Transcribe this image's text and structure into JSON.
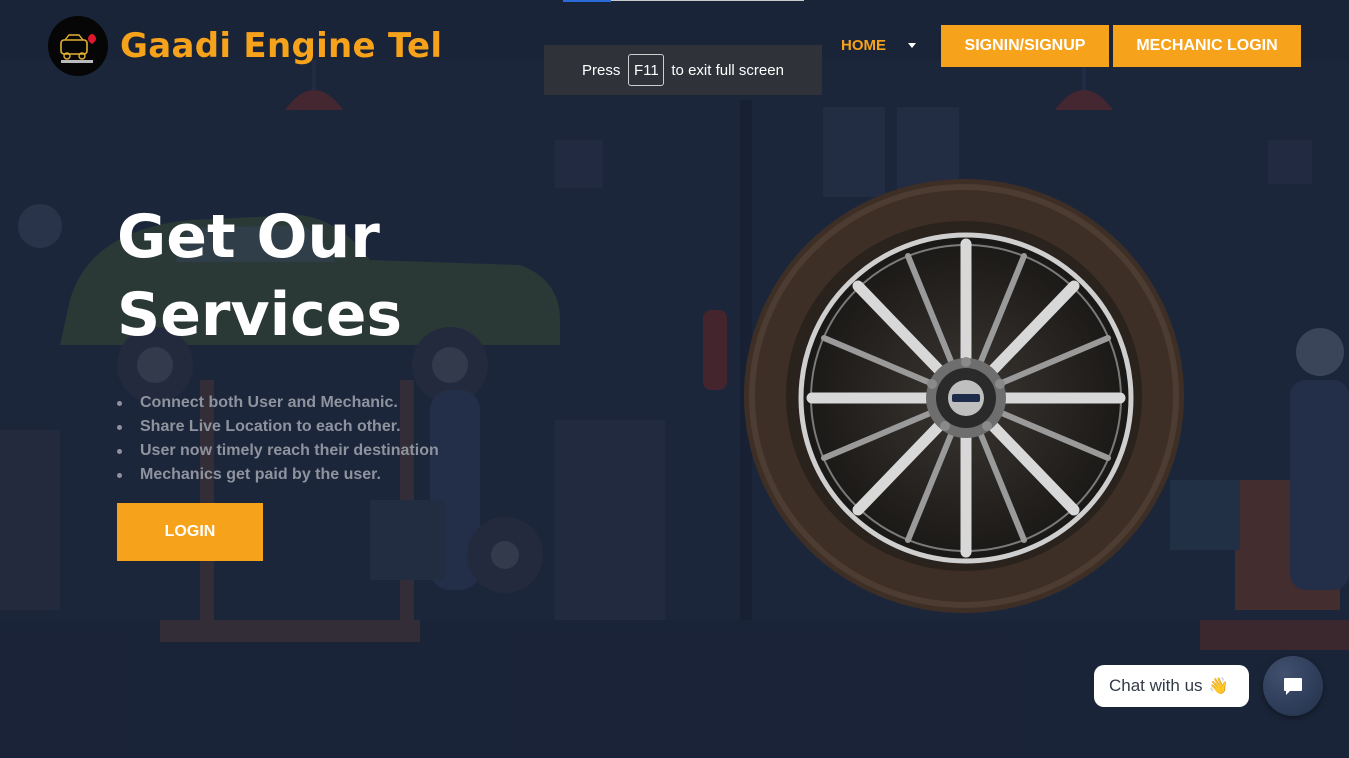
{
  "browser": {
    "fullscreen_hint": {
      "press": "Press",
      "key": "F11",
      "suffix": "to exit full screen"
    }
  },
  "header": {
    "brand": "Gaadi Engine Tel",
    "logo_icon": "car-engine-logo-icon",
    "nav": {
      "home": "HOME",
      "dropdown_icon": "caret-down-icon"
    },
    "signin_button": "SIGNIN/SIGNUP",
    "mechanic_login_button": "MECHANIC LOGIN"
  },
  "hero": {
    "title_line1": "Get Our",
    "title_line2": "Services",
    "features": [
      "Connect both User and Mechanic.",
      "Share Live Location to each other.",
      "User now timely reach their destination",
      "Mechanics get paid by the user."
    ],
    "login_button": "LOGIN",
    "image_icon": "car-wheel-tire-image"
  },
  "chat": {
    "label": "Chat with us",
    "wave_emoji": "👋",
    "chat_icon": "chat-bubble-icon"
  },
  "colors": {
    "accent": "#f7a21b",
    "background": "#1c2438",
    "feature_text": "#8e939d"
  }
}
